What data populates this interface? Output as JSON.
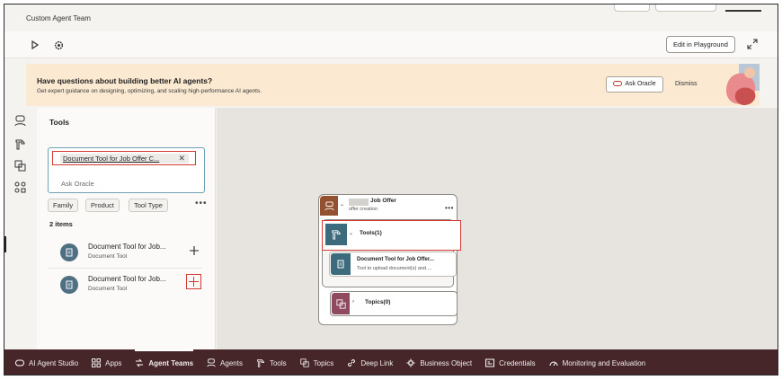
{
  "app": {
    "title": "Custom Agent Team"
  },
  "toolbar": {
    "edit_label": "Edit in Playground"
  },
  "banner": {
    "title": "Have questions about building better AI agents?",
    "subtitle": "Get expert guidance on designing, optimizing, and scaling high-performance AI agents.",
    "ask_label": "Ask Oracle",
    "dismiss_label": "Dismiss"
  },
  "panel": {
    "title": "Tools",
    "search_chip": "Document Tool for Job Offer C...",
    "ask_oracle": "Ask Oracle",
    "filters": [
      "Family",
      "Product",
      "Tool Type"
    ],
    "count": "2 items",
    "items": [
      {
        "name": "Document Tool for Job...",
        "type": "Document Tool"
      },
      {
        "name": "Document Tool for Job...",
        "type": "Document Tool"
      }
    ]
  },
  "canvas": {
    "agent_title": "Job Offer",
    "agent_sub": "offer creation",
    "tools_label": "Tools(1)",
    "tool_name": "Document Tool for Job Offer...",
    "tool_desc": "Tool to upload document(s) and....",
    "topics_label": "Topics(0)"
  },
  "nav": [
    {
      "label": "AI Agent Studio",
      "icon": "studio-icon"
    },
    {
      "label": "Apps",
      "icon": "apps-icon"
    },
    {
      "label": "Agent Teams",
      "icon": "agent-teams-icon",
      "active": true
    },
    {
      "label": "Agents",
      "icon": "agents-icon"
    },
    {
      "label": "Tools",
      "icon": "tools-icon"
    },
    {
      "label": "Topics",
      "icon": "topics-icon"
    },
    {
      "label": "Deep Link",
      "icon": "link-icon"
    },
    {
      "label": "Business Object",
      "icon": "business-object-icon"
    },
    {
      "label": "Credentials",
      "icon": "credentials-icon"
    },
    {
      "label": "Monitoring and Evaluation",
      "icon": "monitoring-icon"
    }
  ],
  "colors": {
    "accent_red": "#d23a33",
    "nav_bg": "#47262a",
    "tool_teal": "#3d6b7e",
    "agent_brown": "#94512f",
    "topic_plum": "#8f4a60"
  }
}
